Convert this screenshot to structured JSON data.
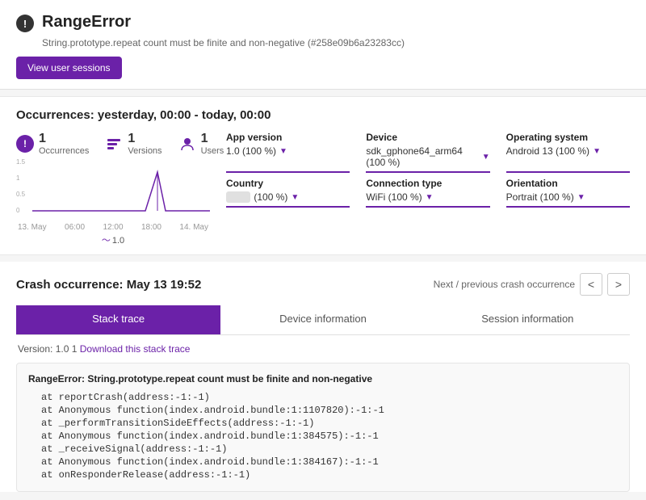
{
  "error": {
    "icon_label": "!",
    "title": "RangeError",
    "subtitle": "String.prototype.repeat count must be finite and non-negative (#258e09b6a23283cc)",
    "view_sessions_label": "View user sessions"
  },
  "occurrences": {
    "title": "Occurrences: yesterday, 00:00 - today, 00:00",
    "stats": [
      {
        "value": "1",
        "label": "Occurrences",
        "icon_type": "warning"
      },
      {
        "value": "1",
        "label": "Versions",
        "icon_type": "stack"
      },
      {
        "value": "1",
        "label": "Users",
        "icon_type": "user"
      }
    ],
    "chart": {
      "y_labels": [
        "1.5",
        "1",
        "0.5",
        "0"
      ],
      "x_labels": [
        "13. May",
        "06:00",
        "12:00",
        "18:00",
        "14. May"
      ],
      "legend": "1.0"
    },
    "filters": [
      {
        "label": "App version",
        "value": "1.0 (100 %)"
      },
      {
        "label": "Device",
        "value": "sdk_gphone64_arm64 (100 %)"
      },
      {
        "label": "Operating system",
        "value": "Android 13 (100 %)"
      },
      {
        "label": "Country",
        "value": "(100 %)",
        "has_tag": true
      },
      {
        "label": "Connection type",
        "value": "WiFi (100 %)"
      },
      {
        "label": "Orientation",
        "value": "Portrait (100 %)"
      }
    ]
  },
  "crash": {
    "title": "Crash occurrence: May 13 19:52",
    "nav_label": "Next / previous crash occurrence",
    "prev_label": "<",
    "next_label": ">",
    "tabs": [
      "Stack trace",
      "Device information",
      "Session information"
    ],
    "active_tab": 0,
    "version_text": "Version: 1.0 1",
    "download_label": "Download this stack trace",
    "stack": {
      "error_message": "RangeError: String.prototype.repeat count must be finite and non-negative",
      "lines": [
        "reportCrash(address:-1:-1)",
        "Anonymous function(index.android.bundle:1:1107820):-1:-1",
        "_performTransitionSideEffects(address:-1:-1)",
        "Anonymous function(index.android.bundle:1:384575):-1:-1",
        "_receiveSignal(address:-1:-1)",
        "Anonymous function(index.android.bundle:1:384167):-1:-1",
        "onResponderRelease(address:-1:-1)"
      ]
    }
  }
}
